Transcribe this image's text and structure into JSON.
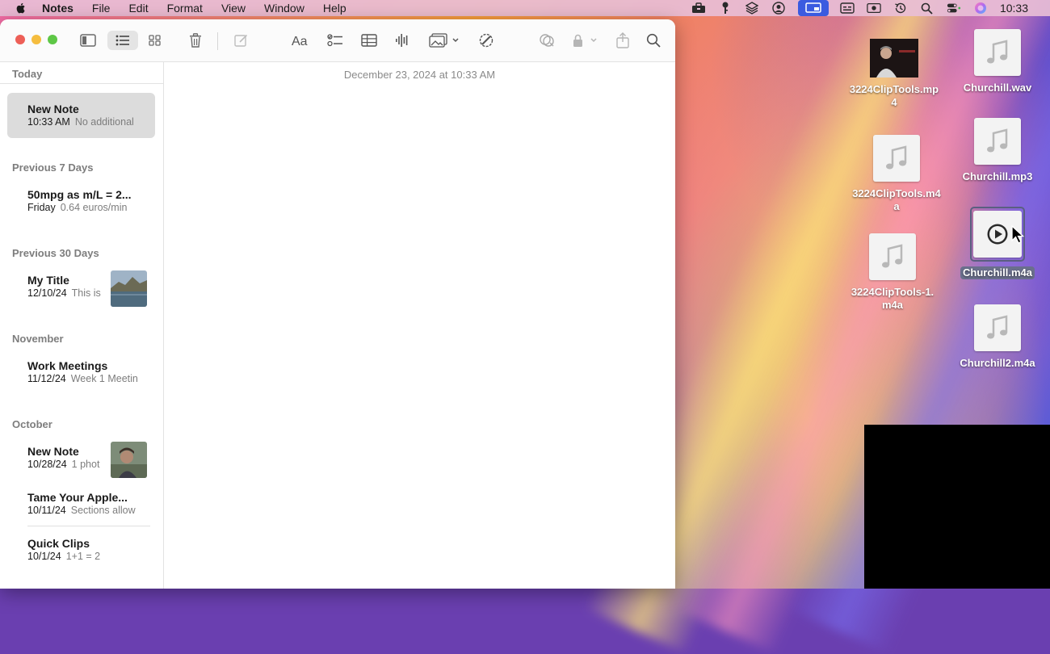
{
  "menubar": {
    "app_name": "Notes",
    "items": [
      "File",
      "Edit",
      "Format",
      "View",
      "Window",
      "Help"
    ],
    "clock": "10:33"
  },
  "toolbar": {
    "icons": [
      "sidebar-toggle-icon",
      "list-view-icon",
      "gallery-view-icon",
      "trash-icon",
      "compose-icon",
      "text-format-icon",
      "checklist-icon",
      "table-icon",
      "audio-icon",
      "media-icon",
      "markup-icon",
      "collaborate-icon",
      "lock-icon",
      "share-icon",
      "search-icon"
    ]
  },
  "sidebar": {
    "sections": {
      "today": "Today",
      "prev7": "Previous 7 Days",
      "prev30": "Previous 30 Days",
      "november": "November",
      "october": "October"
    },
    "notes": [
      {
        "title": "New Note",
        "date": "10:33 AM",
        "snippet": "No additional"
      },
      {
        "title": "50mpg as m/L = 2...",
        "date": "Friday",
        "snippet": "0.64 euros/min"
      },
      {
        "title": "My Title",
        "date": "12/10/24",
        "snippet": "This is"
      },
      {
        "title": "Work Meetings",
        "date": "11/12/24",
        "snippet": "Week 1 Meetin"
      },
      {
        "title": "New Note",
        "date": "10/28/24",
        "snippet": "1 phot"
      },
      {
        "title": "Tame Your Apple...",
        "date": "10/11/24",
        "snippet": "Sections allow"
      },
      {
        "title": "Quick Clips",
        "date": "10/1/24",
        "snippet": "1+1 = 2"
      }
    ]
  },
  "editor": {
    "timestamp": "December 23, 2024 at 10:33 AM"
  },
  "desktop": {
    "files": [
      {
        "name": "3224ClipTools.mp4",
        "line1": "3224ClipTools.mp",
        "line2": "4"
      },
      {
        "name": "Churchill.wav",
        "line1": "Churchill.wav",
        "line2": ""
      },
      {
        "name": "3224ClipTools.m4a",
        "line1": "3224ClipTools.m4",
        "line2": "a"
      },
      {
        "name": "Churchill.mp3",
        "line1": "Churchill.mp3",
        "line2": ""
      },
      {
        "name": "Churchill.m4a",
        "line1": "Churchill.m4a",
        "line2": ""
      },
      {
        "name": "3224ClipTools-1.m4a",
        "line1": "3224ClipTools-1.",
        "line2": "m4a"
      },
      {
        "name": "Churchill2.m4a",
        "line1": "Churchill2.m4a",
        "line2": ""
      }
    ]
  },
  "colors": {
    "close": "#ed5f57",
    "minimize": "#f5bd3f",
    "maximize": "#5ec746",
    "selection": "#dcdcdc",
    "menubar_active": "#3b5be0"
  }
}
